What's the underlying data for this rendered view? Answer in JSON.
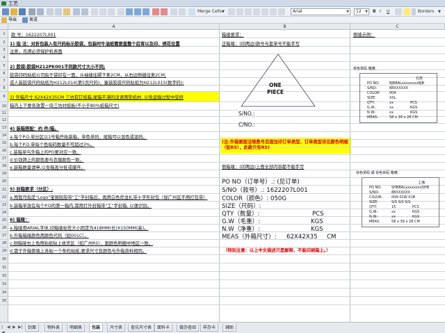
{
  "window": {
    "title": "工艺"
  },
  "toolbar": {
    "merge_label": "Merge Cells",
    "font_name": "Arial",
    "font_size": "12",
    "borders_label": "Borders"
  },
  "toolbar2": {
    "export_label": "导出",
    "send_label": "发送"
  },
  "columns": [
    "A",
    "B",
    "C"
  ],
  "rows": [
    "1",
    "2",
    "3",
    "4",
    "5",
    "6",
    "7",
    "8",
    "9",
    "10",
    "11",
    "12",
    "13",
    "14",
    "15",
    "16",
    "17",
    "18",
    "19",
    "20",
    "21",
    "22",
    "23",
    "24",
    "25",
    "26",
    "27",
    "28",
    "29",
    "30",
    "31",
    "32",
    "33",
    "34",
    "35"
  ],
  "col_a": {
    "model_no": "款    号：1622207L001",
    "r3": "1) 指  法：对折包装入有尺码标示胶袋，包装时牛油纸需要盖整个后背以及印、绣花位置",
    "r3b": "注意，吊牌必须保护机表面",
    "r5": "2) 胶袋:胶袋H212PK001不同款尺寸大小不同;",
    "r6": "胶袋印码贴纸公司贴于袋印在一面，从袖缝往脚下来2CM，从右边侧缝往来2CM;",
    "r7": "成人装胶袋尺码贴纸为H212L014(第5页尺码)，童装胶袋尺码贴纸为H212L015(数字码);",
    "r9": "3) 外箱尺寸 62X42X35CM 三坑有钉纸箱,尾箱不满的话请用垫纸材, 以免运输过程中受挤",
    "r10": "箱内上下要各放置一块三坑衬纸板(不小于80%纸箱尺寸)",
    "r13": "4) 装箱搭配：约  件/箱。",
    "r14": "a.每个P.O.单分区以1号箱开始装箱，单色单码，尾箱可以混色或混码。",
    "r15": "b.每个P.O.单每个色每码数量不可超过3%。",
    "r16": "c.装箱单与外箱上的PO要对应一致。",
    "r17": "d.价钱牌上的颜色要与衣服颜色一致。",
    "r18": "e.装箱数量请申,以免箱盖分批或爆开。",
    "r20": "5) 封箱要求（分区）.",
    "r21": "a.用我司指定\"Logo\"宝丽胶胶带\"工\"字封箱后，再用白色尼龙扎带十字形封包（除广州区不用打包带）",
    "r22": "b.装箱单放在每个P.O的第一箱内,需用打外封箱带\"工\"字封箱, 以便识别。",
    "r24": "6) 箱唛：",
    "r25": "a.箱唛用ARIAL字体,印箱唛标签大小固定为418MM(长)X150MM(高)。",
    "r26": "b.外箱箱唛颜色用颜色代码（如001C）。",
    "r27": "c.侧箱唛右上角用贴纸贴上收货区（如广州RS），跟颜色明细中地区一致。",
    "r28": "d.需于外箱侧唛上各贴一个条码贴纸,要求尺寸及颜色与外箱资料相同。"
  },
  "col_b": {
    "header": "箱唛要求：",
    "r2": "正箱唛：(印两边)款号与套单号不能手写",
    "one_piece_1": "ONE",
    "one_piece_2": "PIECE",
    "sno": "S/NO.:",
    "cno": "C/NO.:",
    "yellow_note": "(注:外箱侧面注唛数号后面加印订单类型，订单类型详见颜色明细（如RS），此款只有RS)",
    "side_mark": "侧箱唛：(印两边)上面全部内容都不能手写",
    "po_no": "PO NO（订单号）.: (见订单)",
    "style_no": "S/NO（款号）.: 1622207L001",
    "color": "COLOR（颜色）: 050G",
    "size": "SIZE（尺码）:",
    "qty": "QTY（数量）:",
    "qty_unit": "PCS",
    "gw": "G.W（毛重）:",
    "gw_unit": "KGS",
    "nw": "N.W（净重）:",
    "nw_unit": "KGS",
    "meas": "MEAS（外箱尺寸）:",
    "meas_val": "62X42X35",
    "meas_unit": "CM",
    "special_note": "（特别注意：以上中文描述只是解释，不能印刷箱上。）"
  },
  "col_c": {
    "header": "侧唛示例：",
    "sample1_title": "单色单码 箱唛:",
    "sample1_city": "北京",
    "sample1_rows": [
      [
        "PO NO:",
        "BJBBALxxxxxxxxBJB"
      ],
      [
        "S/NO:",
        "88XXXXXX"
      ],
      [
        "COLOR:",
        "00A"
      ],
      [
        "SIZE:",
        "XXL"
      ],
      [
        "QTY:",
        "xx",
        "PCS"
      ],
      [
        "G.W.:",
        "xx",
        "KGS"
      ],
      [
        "N.W.:",
        "xx",
        "KGS"
      ],
      [
        "MEAS:",
        "58 x 39 x 28 CM"
      ]
    ],
    "sample2_title": "杂色单码 或 杂色杂码 箱唛:",
    "sample2_city": "上海",
    "sample2_rows": [
      [
        "PO NO:",
        "SHBBALxxxxxxxxSHB"
      ],
      [
        "S/NO:",
        "88XXXXXX"
      ],
      [
        "COLOR:",
        "00A  01W  01B"
      ],
      [
        "SIZE:",
        "S/S  S/S  S/S"
      ],
      [
        "QTY:",
        "15",
        "PCS"
      ],
      [
        "G.W.:",
        "xx",
        "KGS"
      ],
      [
        "N.W.:",
        "xx",
        "KGS"
      ],
      [
        "MEAS:",
        "58 x 39 x 28 CM"
      ]
    ]
  },
  "sheet_tabs": [
    "封面",
    "物料表",
    "明细表",
    "包装",
    "尺寸表",
    "查坑尺寸表",
    "面料卡",
    "做办查阅",
    "样办卡",
    "辅助"
  ],
  "active_tab": "包装"
}
